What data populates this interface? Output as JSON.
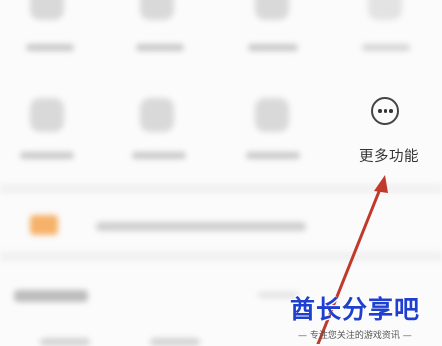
{
  "more_functions": {
    "label": "更多功能",
    "icon": "more-horizontal-icon"
  },
  "watermark": {
    "brand": "酋长分享吧",
    "tagline": "— 专注您关注的游戏资讯 —"
  },
  "colors": {
    "arrow": "#c0392b",
    "watermark": "#1f3fcf"
  }
}
